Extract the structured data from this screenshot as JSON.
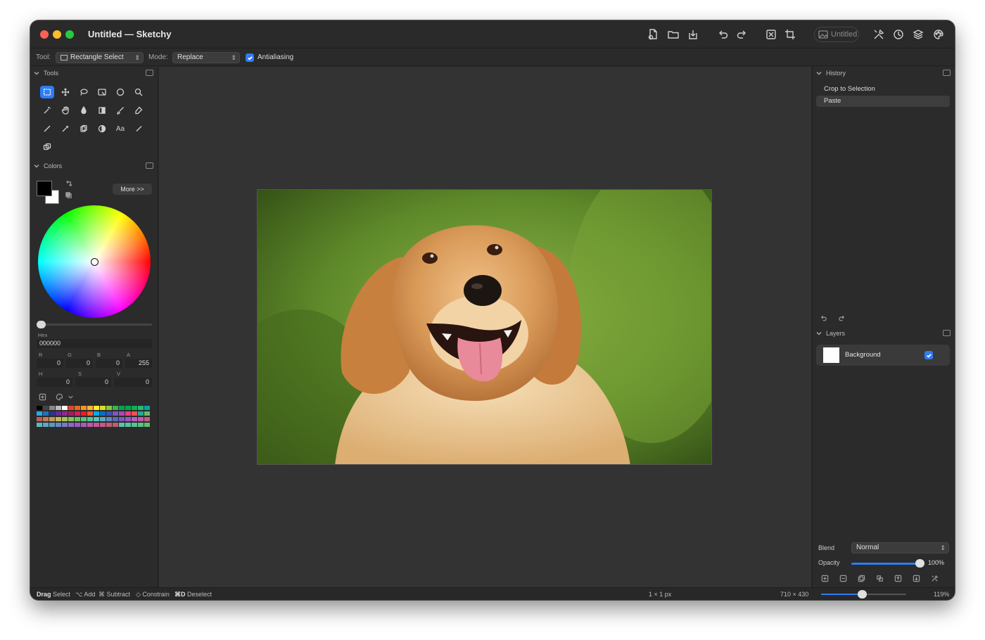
{
  "window": {
    "title": "Untitled — Sketchy",
    "doc_badge": "Untitled"
  },
  "options": {
    "tool_label": "Tool:",
    "tool_value": "Rectangle Select",
    "mode_label": "Mode:",
    "mode_value": "Replace",
    "antialiasing_label": "Antialiasing",
    "antialiasing_checked": true
  },
  "tools_panel": {
    "title": "Tools",
    "text_tool_label": "Aa"
  },
  "colors_panel": {
    "title": "Colors",
    "more_button": "More >>",
    "hex_label": "Hex",
    "hex_value": "000000",
    "r_label": "R",
    "g_label": "G",
    "b_label": "B",
    "a_label": "A",
    "r": "0",
    "g": "0",
    "b": "0",
    "a": "255",
    "h_label": "H",
    "s_label": "S",
    "v_label": "V",
    "h": "0",
    "s": "0",
    "v": "0",
    "swatches": [
      [
        "#000000",
        "#444444",
        "#888888",
        "#bbbbbb",
        "#ffffff",
        "#e8442e",
        "#f26522",
        "#f7941d",
        "#fbb040",
        "#f9ed32",
        "#d7df23",
        "#8dc63f",
        "#39b54a",
        "#00a651",
        "#00a651",
        "#0db14b",
        "#2bb673",
        "#00a79d"
      ],
      [
        "#27aae1",
        "#1c75bc",
        "#2e3192",
        "#662d91",
        "#92278f",
        "#9e1f63",
        "#da1c5c",
        "#ed1c24",
        "#f15a29",
        "#00aeef",
        "#0072bc",
        "#3f51b5",
        "#7e57c2",
        "#ab47bc",
        "#ec407a",
        "#ef5350",
        "#26a69a",
        "#66bb6a"
      ],
      [
        "#c25a5a",
        "#c27a5a",
        "#c29a5a",
        "#c2ba5a",
        "#aac25a",
        "#8ac25a",
        "#6ac25a",
        "#5ac27a",
        "#5ac29a",
        "#5ac2ba",
        "#5aaac2",
        "#5a8ac2",
        "#5a6ac2",
        "#7a5ac2",
        "#9a5ac2",
        "#ba5ac2",
        "#c25aaa",
        "#c25a8a"
      ],
      [
        "#5ab9c2",
        "#5aa9c2",
        "#5a99c2",
        "#6a8ac2",
        "#7a7ac2",
        "#8a6ac2",
        "#9a5ac2",
        "#aa5ab9",
        "#ba5aa9",
        "#c25a99",
        "#c25a89",
        "#c25a79",
        "#c25a69",
        "#5ac2b0",
        "#5ac2a0",
        "#5ac290",
        "#5ac280",
        "#5ac270"
      ]
    ]
  },
  "history_panel": {
    "title": "History",
    "items": [
      "Crop to Selection",
      "Paste"
    ]
  },
  "layers_panel": {
    "title": "Layers",
    "layers": [
      {
        "name": "Background",
        "visible": true
      }
    ],
    "blend_label": "Blend",
    "blend_value": "Normal",
    "opacity_label": "Opacity",
    "opacity_value": "100%",
    "opacity_fraction": 1.0
  },
  "status": {
    "hint_drag": "Drag",
    "hint_drag_txt": "Select",
    "hint_add": "⌥ Add",
    "hint_subtract": "⌘ Subtract",
    "hint_constrain": "◇ Constrain",
    "hint_deselect_key": "⌘D",
    "hint_deselect_txt": "Deselect",
    "selection_size": "1 × 1 px",
    "image_size": "710 × 430",
    "zoom": "119%"
  },
  "colors": {
    "accent": "#2e7cf6",
    "canvas_bg": "#333333",
    "panel_bg": "#2b2b2b"
  }
}
